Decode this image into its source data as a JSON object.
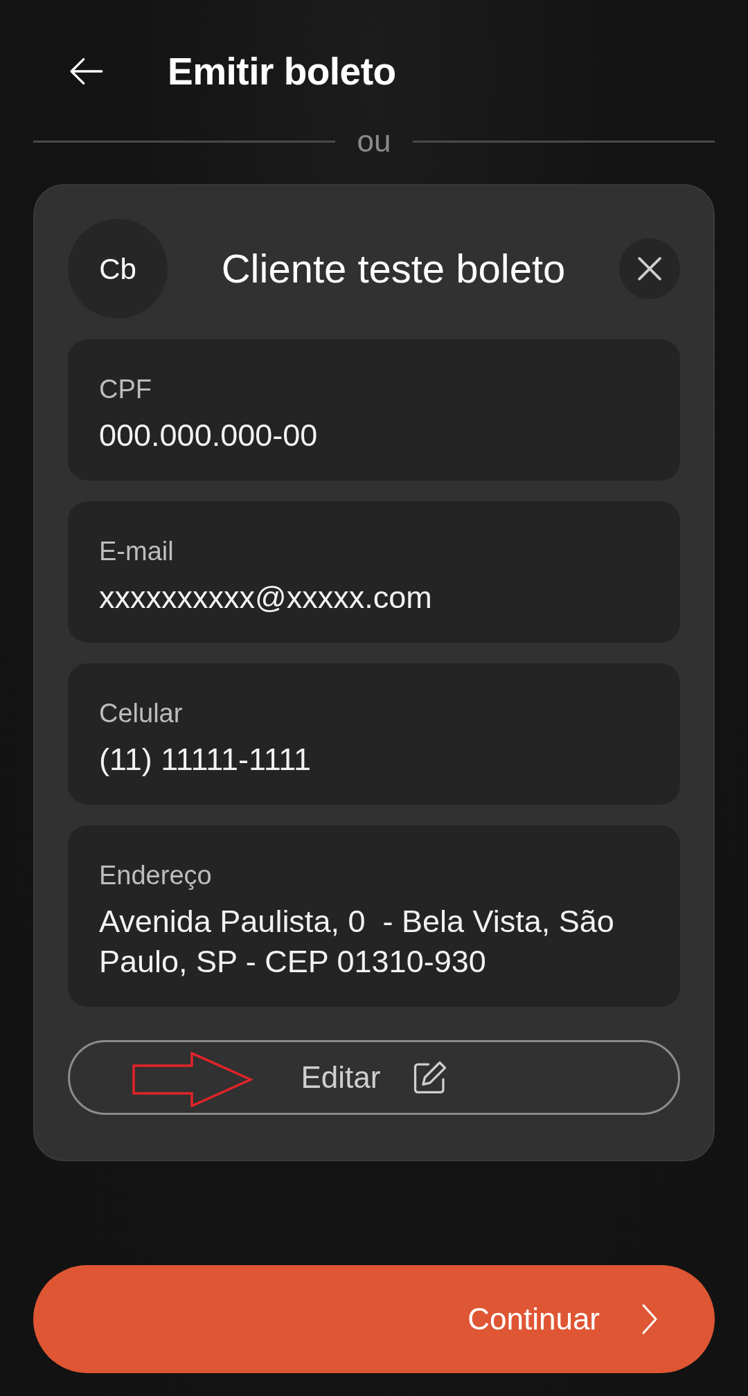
{
  "header": {
    "title": "Emitir boleto"
  },
  "divider": {
    "label": "ou"
  },
  "client_card": {
    "avatar_initials": "Cb",
    "name": "Cliente teste boleto",
    "fields": [
      {
        "label": "CPF",
        "value": "000.000.000-00"
      },
      {
        "label": "E-mail",
        "value": "xxxxxxxxxx@xxxxx.com"
      },
      {
        "label": "Celular",
        "value": "(11) 11111-1111"
      },
      {
        "label": "Endereço",
        "value": "Avenida Paulista, 0  - Bela Vista, São Paulo, SP - CEP 01310-930"
      }
    ],
    "edit_button": {
      "label": "Editar"
    }
  },
  "continue_button": {
    "label": "Continuar"
  }
}
